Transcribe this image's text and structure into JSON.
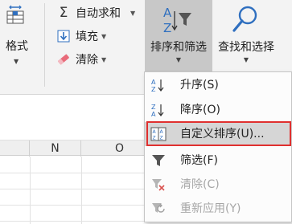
{
  "ribbon": {
    "format_label": "格式",
    "editing": {
      "autosum_label": "自动求和",
      "fill_label": "填充",
      "clear_label": "清除"
    },
    "sort_filter_label": "排序和筛选",
    "find_select_label": "查找和选择"
  },
  "sheet": {
    "columns": [
      "N",
      "O"
    ]
  },
  "menu": {
    "items": [
      {
        "label": "升序(S)",
        "icon": "sort-ascending-icon",
        "enabled": true
      },
      {
        "label": "降序(O)",
        "icon": "sort-descending-icon",
        "enabled": true
      },
      {
        "label": "自定义排序(U)...",
        "icon": "custom-sort-icon",
        "enabled": true
      },
      {
        "label": "筛选(F)",
        "icon": "filter-icon",
        "enabled": true
      },
      {
        "label": "清除(C)",
        "icon": "clear-filter-icon",
        "enabled": false
      },
      {
        "label": "重新应用(Y)",
        "icon": "reapply-icon",
        "enabled": false
      }
    ]
  },
  "colors": {
    "highlight_border": "#e0302f",
    "sort_az_blue": "#2f6fbf",
    "clear_red": "#d9534f"
  }
}
